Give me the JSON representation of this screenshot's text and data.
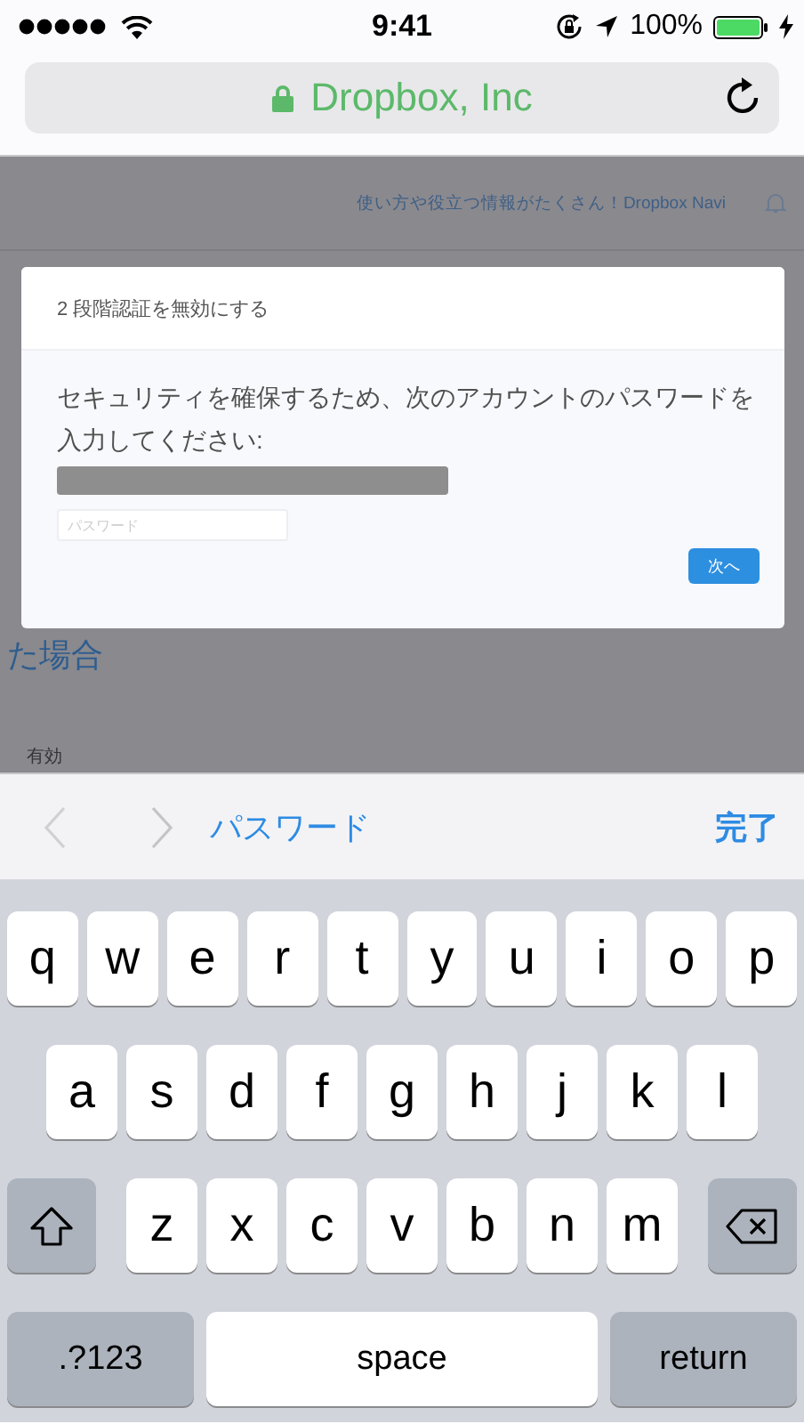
{
  "status_bar": {
    "time": "9:41",
    "battery": "100%"
  },
  "address_bar": {
    "title": "Dropbox, Inc"
  },
  "page": {
    "navi_link": "使い方や役立つ情報がたくさん！Dropbox Navi",
    "heading_fragment": "た場合",
    "status_label": "有効"
  },
  "dialog": {
    "title": "2 段階認証を無効にする",
    "message": "セキュリティを確保するため、次のアカウントのパスワードを入力してください:",
    "password_placeholder": "パスワード",
    "next_button": "次へ"
  },
  "accessory_bar": {
    "previous_disabled": true,
    "next_disabled": true,
    "field_label": "パスワード",
    "done": "完了"
  },
  "keyboard": {
    "rows": [
      {
        "keys": [
          {
            "label": "q",
            "kind": "letter"
          },
          {
            "label": "w",
            "kind": "letter"
          },
          {
            "label": "e",
            "kind": "letter"
          },
          {
            "label": "r",
            "kind": "letter"
          },
          {
            "label": "t",
            "kind": "letter"
          },
          {
            "label": "y",
            "kind": "letter"
          },
          {
            "label": "u",
            "kind": "letter"
          },
          {
            "label": "i",
            "kind": "letter"
          },
          {
            "label": "o",
            "kind": "letter"
          },
          {
            "label": "p",
            "kind": "letter"
          }
        ]
      },
      {
        "keys": [
          {
            "label": "a",
            "kind": "letter"
          },
          {
            "label": "s",
            "kind": "letter"
          },
          {
            "label": "d",
            "kind": "letter"
          },
          {
            "label": "f",
            "kind": "letter"
          },
          {
            "label": "g",
            "kind": "letter"
          },
          {
            "label": "h",
            "kind": "letter"
          },
          {
            "label": "j",
            "kind": "letter"
          },
          {
            "label": "k",
            "kind": "letter"
          },
          {
            "label": "l",
            "kind": "letter"
          }
        ]
      },
      {
        "keys": [
          {
            "kind": "shift"
          },
          {
            "label": "z",
            "kind": "letter"
          },
          {
            "label": "x",
            "kind": "letter"
          },
          {
            "label": "c",
            "kind": "letter"
          },
          {
            "label": "v",
            "kind": "letter"
          },
          {
            "label": "b",
            "kind": "letter"
          },
          {
            "label": "n",
            "kind": "letter"
          },
          {
            "label": "m",
            "kind": "letter"
          },
          {
            "kind": "delete"
          }
        ]
      },
      {
        "keys": [
          {
            "label": ".?123",
            "kind": "mode"
          },
          {
            "label": "space",
            "kind": "space"
          },
          {
            "label": "return",
            "kind": "return"
          }
        ]
      }
    ]
  }
}
